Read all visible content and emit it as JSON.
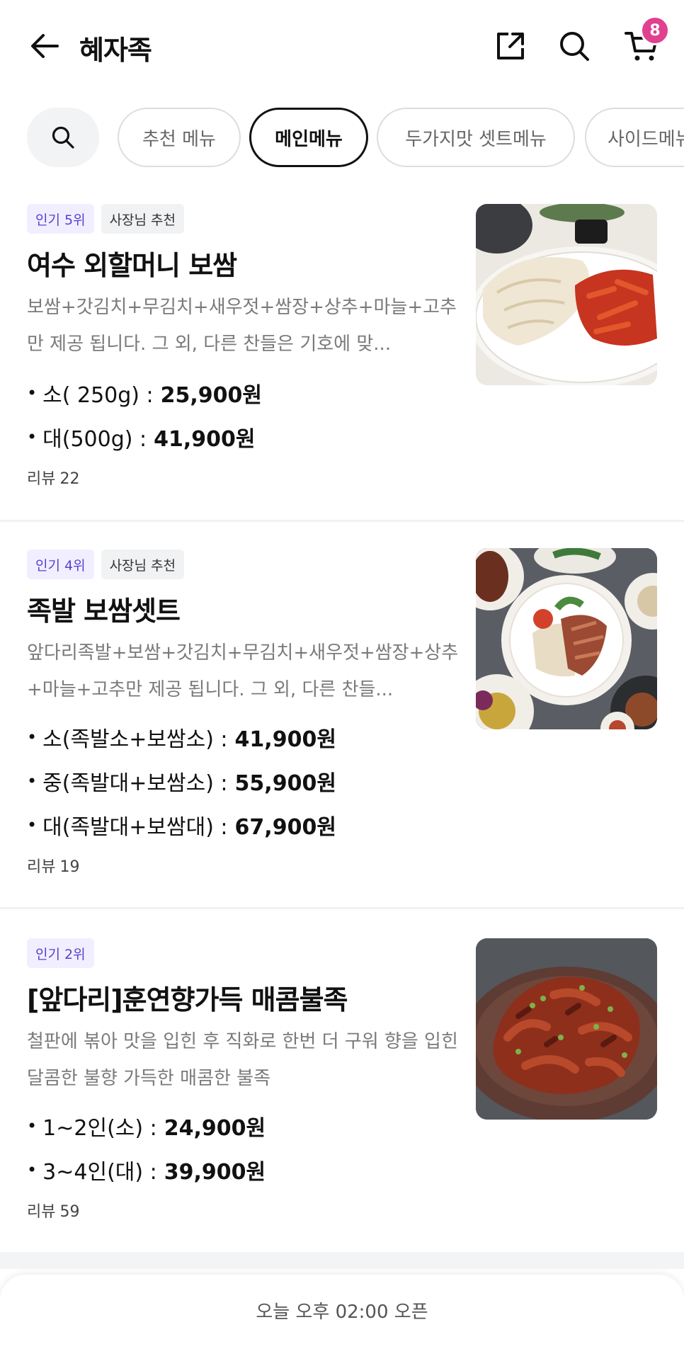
{
  "header": {
    "store_name": "혜자족",
    "cart_count": "8",
    "icons": {
      "back": "arrow-left-icon",
      "share": "share-icon",
      "search": "search-icon",
      "cart": "cart-icon"
    }
  },
  "tabs": [
    {
      "label": "추천 메뉴",
      "active": false
    },
    {
      "label": "메인메뉴",
      "active": true
    },
    {
      "label": "두가지맛 셋트메뉴",
      "active": false
    },
    {
      "label": "사이드메뉴",
      "active": false
    }
  ],
  "menu_items": [
    {
      "rank_badge": "인기 5위",
      "owner_badge": "사장님 추천",
      "name": "여수 외할머니 보쌈",
      "description": "보쌈+갓김치+무김치+새우젓+쌈장+상추+마늘+고추만 제공 됩니다. 그 외, 다른 찬들은 기호에 맞...",
      "prices": [
        {
          "label": "소( 250g) :",
          "price": "25,900원"
        },
        {
          "label": "대(500g) :",
          "price": "41,900원"
        }
      ],
      "review_label": "리뷰",
      "review_count": "22"
    },
    {
      "rank_badge": "인기 4위",
      "owner_badge": "사장님 추천",
      "name": "족발 보쌈셋트",
      "description": "앞다리족발+보쌈+갓김치+무김치+새우젓+쌈장+상추+마늘+고추만 제공 됩니다. 그 외, 다른 찬들...",
      "prices": [
        {
          "label": "소(족발소+보쌈소) :",
          "price": "41,900원"
        },
        {
          "label": "중(족발대+보쌈소) :",
          "price": "55,900원"
        },
        {
          "label": "대(족발대+보쌈대) :",
          "price": "67,900원"
        }
      ],
      "review_label": "리뷰",
      "review_count": "19"
    },
    {
      "rank_badge": "인기 2위",
      "name": "[앞다리]훈연향가득 매콤불족",
      "description": "철판에 볶아 맛을 입힌 후 직화로 한번 더 구워 향을 입힌 달콤한 불향 가득한 매콤한 불족",
      "prices": [
        {
          "label": "1~2인(소) :",
          "price": "24,900원"
        },
        {
          "label": "3~4인(대) :",
          "price": "39,900원"
        }
      ],
      "review_label": "리뷰",
      "review_count": "59"
    }
  ],
  "bottom_bar": {
    "open_notice": "오늘 오후 02:00 오픈"
  },
  "colors": {
    "badge_rank_text": "#5b3fd0",
    "badge_rank_bg": "#f1efff",
    "cart_badge": "#e0408f",
    "active_tab_border": "#111111"
  }
}
